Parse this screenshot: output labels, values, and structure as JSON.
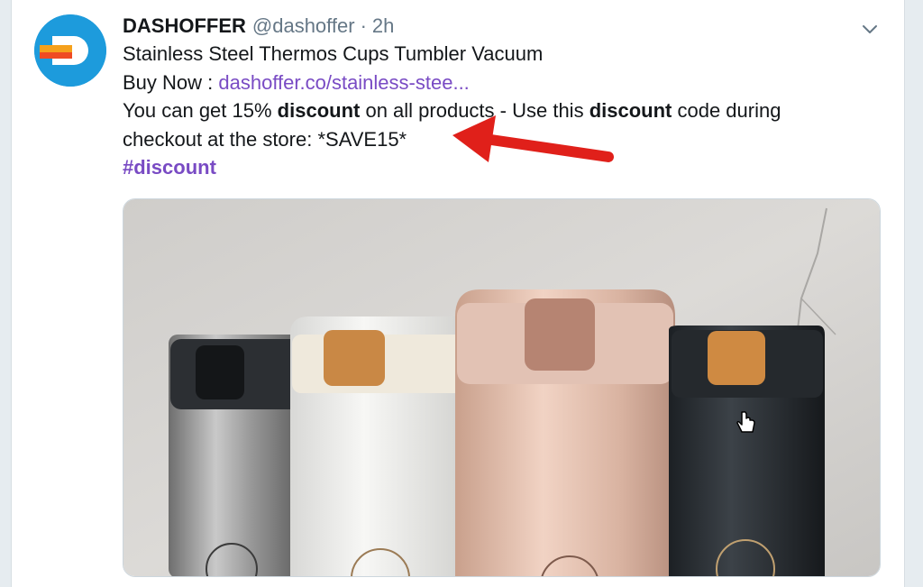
{
  "tweet": {
    "author_name": "DASHOFFER",
    "author_handle": "@dashoffer",
    "separator": "·",
    "timestamp": "2h",
    "title_line": "Stainless Steel Thermos Cups Tumbler Vacuum",
    "buy_label": "Buy Now : ",
    "buy_link": "dashoffer.co/stainless-stee...",
    "discount_line_1": {
      "part1": "You can get 15% ",
      "bold1": "discount",
      "part2": " on all products - Use this ",
      "bold2": "discount",
      "part3": " code during"
    },
    "discount_line_2": "checkout at the store: *SAVE15*",
    "hashtag": "#discount"
  },
  "icons": {
    "avatar": "dashoffer-logo-icon",
    "menu": "chevron-down-icon",
    "annotation": "red-arrow-icon",
    "pointer": "hand-cursor-icon"
  },
  "colors": {
    "link": "#794bc4",
    "handle": "#657786",
    "avatar_bg": "#1d9bdc",
    "arrow": "#e0201a"
  }
}
